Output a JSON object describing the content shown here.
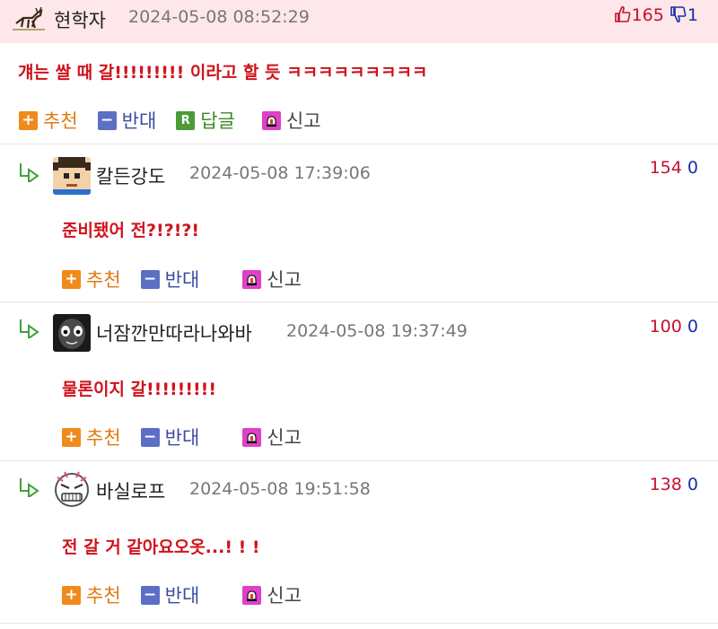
{
  "comments": [
    {
      "nickname": "현학자",
      "date": "2024-05-08 08:52:29",
      "up": "165",
      "down": "1",
      "text": "걔는 쌀 때 갈!!!!!!!!! 이라고 할 듯 ㅋㅋㅋㅋㅋㅋㅋㅋㅋ",
      "actions": {
        "recommend": "추천",
        "oppose": "반대",
        "reply": "답글",
        "report": "신고"
      },
      "avatar": "deer-icon"
    },
    {
      "nickname": "칼든강도",
      "date": "2024-05-08 17:39:06",
      "up": "154",
      "down": "0",
      "text": "준비됐어 전?!?!?!",
      "actions": {
        "recommend": "추천",
        "oppose": "반대",
        "report": "신고"
      },
      "avatar": "pixel-face-icon"
    },
    {
      "nickname": "너잠깐만따라나와바",
      "date": "2024-05-08 19:37:49",
      "up": "100",
      "down": "0",
      "text": "물론이지 갈!!!!!!!!!",
      "actions": {
        "recommend": "추천",
        "oppose": "반대",
        "report": "신고"
      },
      "avatar": "dark-face-icon"
    },
    {
      "nickname": "바실로프",
      "date": "2024-05-08 19:51:58",
      "up": "138",
      "down": "0",
      "text": "전 갈 거 같아요오옷...! ! !",
      "actions": {
        "recommend": "추천",
        "oppose": "반대",
        "report": "신고"
      },
      "avatar": "angry-face-icon"
    }
  ],
  "colors": {
    "header_bg": "#fde7ea",
    "comment_text": "#d0121b",
    "upvote": "#c8102e",
    "downvote": "#1a2fa8"
  }
}
